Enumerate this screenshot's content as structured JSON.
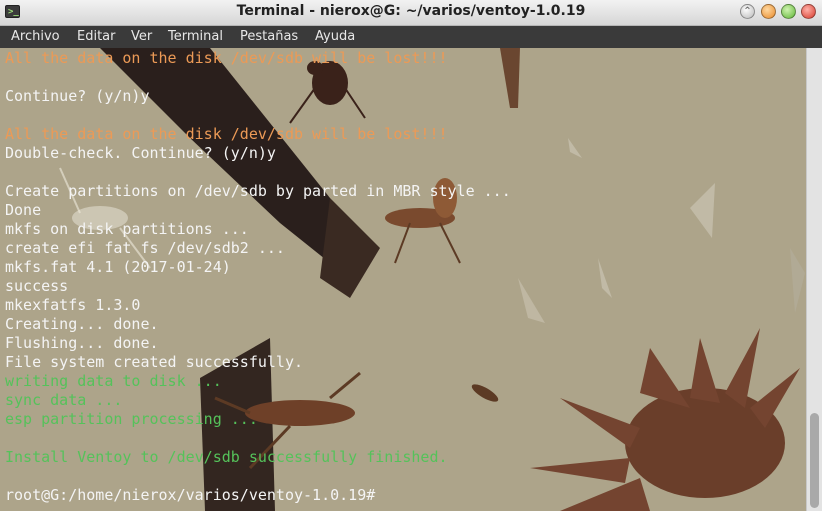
{
  "window": {
    "title": "Terminal - nierox@G: ~/varios/ventoy-1.0.19",
    "app_icon_glyph": ">_"
  },
  "menu": [
    "Archivo",
    "Editar",
    "Ver",
    "Terminal",
    "Pestañas",
    "Ayuda"
  ],
  "terminal": {
    "lines": [
      {
        "text": "All the data on the disk /dev/sdb will be lost!!!",
        "color": "orange"
      },
      {
        "text": "",
        "color": "white"
      },
      {
        "text": "Continue? (y/n)y",
        "color": "white"
      },
      {
        "text": "",
        "color": "white"
      },
      {
        "text": "All the data on the disk /dev/sdb will be lost!!!",
        "color": "orange"
      },
      {
        "text": "Double-check. Continue? (y/n)y",
        "color": "white"
      },
      {
        "text": "",
        "color": "white"
      },
      {
        "text": "Create partitions on /dev/sdb by parted in MBR style ...",
        "color": "white"
      },
      {
        "text": "Done",
        "color": "white"
      },
      {
        "text": "mkfs on disk partitions ...",
        "color": "white"
      },
      {
        "text": "create efi fat fs /dev/sdb2 ...",
        "color": "white"
      },
      {
        "text": "mkfs.fat 4.1 (2017-01-24)",
        "color": "white"
      },
      {
        "text": "success",
        "color": "white"
      },
      {
        "text": "mkexfatfs 1.3.0",
        "color": "white"
      },
      {
        "text": "Creating... done.",
        "color": "white"
      },
      {
        "text": "Flushing... done.",
        "color": "white"
      },
      {
        "text": "File system created successfully.",
        "color": "white"
      },
      {
        "text": "writing data to disk ...",
        "color": "green"
      },
      {
        "text": "sync data ...",
        "color": "green"
      },
      {
        "text": "esp partition processing ...",
        "color": "green"
      },
      {
        "text": "",
        "color": "white"
      },
      {
        "text": "Install Ventoy to /dev/sdb successfully finished.",
        "color": "green"
      },
      {
        "text": "",
        "color": "white"
      },
      {
        "text": "root@G:/home/nierox/varios/ventoy-1.0.19#",
        "color": "white"
      }
    ]
  },
  "colors": {
    "terminal_white": "#f4f4f4",
    "terminal_orange": "#ec9a56",
    "terminal_green": "#55c25a",
    "menubar_bg": "#3a3a3a",
    "wallpaper_bg": "#aea58b"
  }
}
